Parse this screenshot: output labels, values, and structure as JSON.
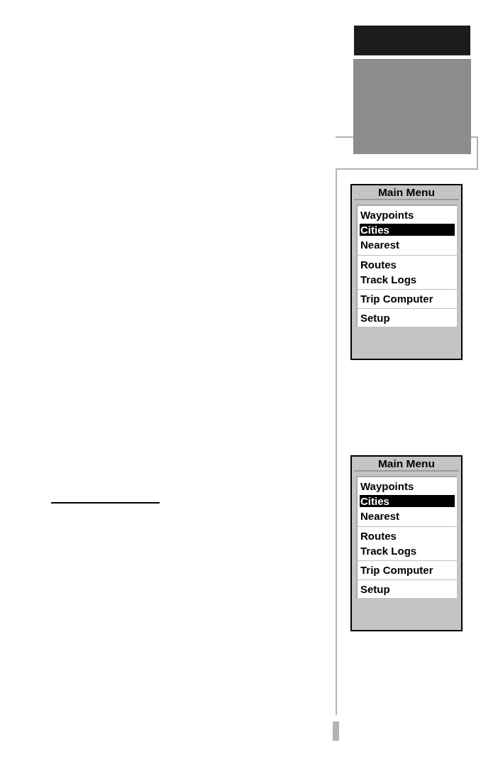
{
  "screens": [
    {
      "title": "Main Menu",
      "groups": [
        {
          "items": [
            {
              "label": "Waypoints",
              "selected": false
            },
            {
              "label": "Cities",
              "selected": true
            },
            {
              "label": "Nearest",
              "selected": false
            }
          ]
        },
        {
          "items": [
            {
              "label": "Routes",
              "selected": false
            },
            {
              "label": "Track Logs",
              "selected": false
            }
          ]
        },
        {
          "items": [
            {
              "label": "Trip Computer",
              "selected": false
            }
          ]
        },
        {
          "items": [
            {
              "label": "Setup",
              "selected": false
            }
          ]
        }
      ]
    },
    {
      "title": "Main Menu",
      "groups": [
        {
          "items": [
            {
              "label": "Waypoints",
              "selected": false
            },
            {
              "label": "Cities",
              "selected": true
            },
            {
              "label": "Nearest",
              "selected": false
            }
          ]
        },
        {
          "items": [
            {
              "label": "Routes",
              "selected": false
            },
            {
              "label": "Track Logs",
              "selected": false
            }
          ]
        },
        {
          "items": [
            {
              "label": "Trip Computer",
              "selected": false
            }
          ]
        },
        {
          "items": [
            {
              "label": "Setup",
              "selected": false
            }
          ]
        }
      ]
    }
  ]
}
